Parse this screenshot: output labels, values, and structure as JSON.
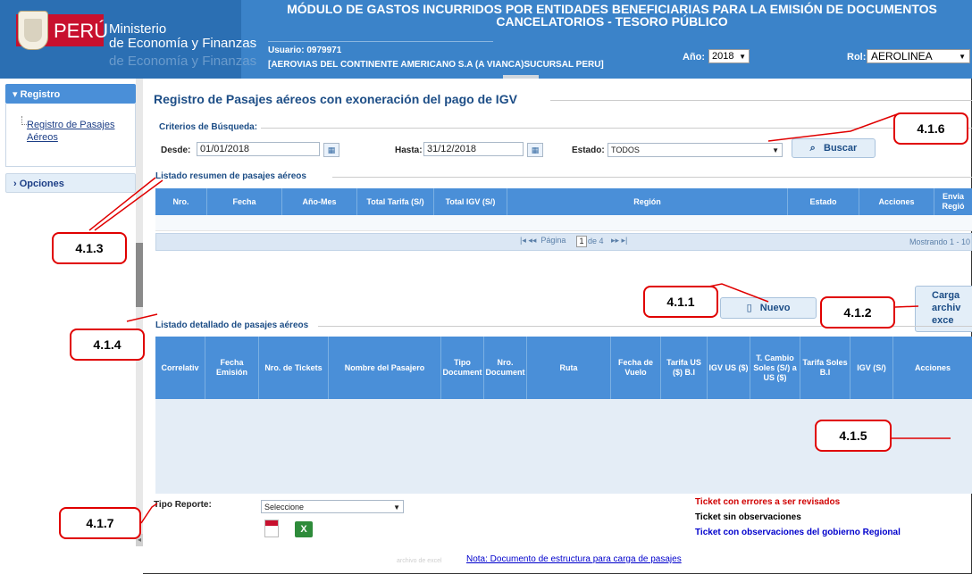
{
  "header": {
    "logo_text": "PERÚ",
    "ministry_line1": "Ministerio",
    "ministry_line2": "de Economía y Finanzas",
    "ministry_ghost": "de Economía y Finanzas",
    "title": "MÓDULO DE GASTOS INCURRIDOS POR ENTIDADES BENEFICIARIAS PARA LA EMISIÓN DE DOCUMENTOS CANCELATORIOS - TESORO PÚBLICO",
    "user_label": "Usuario: 0979971",
    "user_name": "[AEROVIAS DEL CONTINENTE AMERICANO S.A (A VIANCA)SUCURSAL PERU]",
    "year_label": "Año:",
    "year_value": "2018",
    "role_label": "Rol:",
    "role_value": "AEROLINEA",
    "brand_color": "#3b83c9"
  },
  "sidebar": {
    "section_registro": "Registro",
    "link_registro": "Registro de Pasajes Aéreos",
    "section_opciones": "Opciones"
  },
  "page": {
    "title": "Registro de Pasajes aéreos con exoneración del pago de IGV",
    "criteria_legend": "Criterios de Búsqueda:",
    "desde_label": "Desde:",
    "desde_value": "01/01/2018",
    "hasta_label": "Hasta:",
    "hasta_value": "31/12/2018",
    "estado_label": "Estado:",
    "estado_value": "TODOS",
    "buscar_label": "Buscar",
    "summary_legend": "Listado resumen de pasajes aéreos",
    "summary_columns": [
      "Nro.",
      "Fecha",
      "Año-Mes",
      "Total Tarifa (S/)",
      "Total IGV (S/)",
      "Región",
      "Estado",
      "Acciones",
      "Envia Regió"
    ],
    "pager_page_label": "Página",
    "pager_page": "1",
    "pager_of": "de 4",
    "pager_showing": "Mostrando 1 - 10",
    "nuevo_label": "Nuevo",
    "cargar_label": "Carga archiv exce",
    "detail_legend": "Listado detallado de pasajes aéreos",
    "detail_columns": [
      "Correlativ",
      "Fecha Emisión",
      "Nro. de Tickets",
      "Nombre del Pasajero",
      "Tipo Document",
      "Nro. Document",
      "Ruta",
      "Fecha de Vuelo",
      "Tarifa US ($) B.I",
      "IGV US ($)",
      "T. Cambio Soles (S/) a US ($)",
      "Tarifa Soles B.I",
      "IGV (S/)",
      "Acciones"
    ],
    "tipo_reporte_label": "Tipo Reporte:",
    "tipo_reporte_value": "Seleccione",
    "legend_red": "Ticket con errores a ser revisados",
    "legend_black": "Ticket sin observaciones",
    "legend_blue": "Ticket con observaciones del gobierno Regional",
    "nota": "Nota: Documento de estructura para carga de pasajes",
    "nota_ghost": "archivo de excel"
  },
  "callouts": {
    "c416": "4.1.6",
    "c413": "4.1.3",
    "c411": "4.1.1",
    "c412": "4.1.2",
    "c414": "4.1.4",
    "c415": "4.1.5",
    "c417": "4.1.7",
    "color": "#e00000"
  }
}
